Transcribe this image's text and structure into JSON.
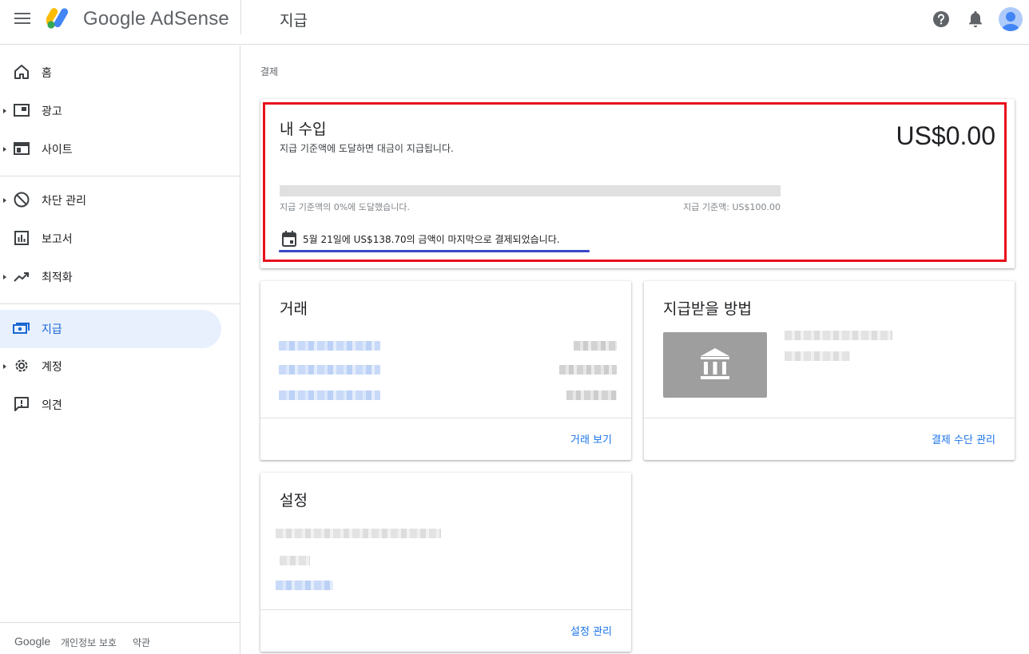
{
  "app": {
    "brand": "Google AdSense",
    "page_title": "지급"
  },
  "header": {
    "icons": [
      "menu-icon",
      "help-icon",
      "notifications-icon",
      "account-avatar"
    ]
  },
  "sidebar": {
    "items": [
      {
        "label": "홈",
        "icon": "home-icon",
        "expandable": false,
        "active": false
      },
      {
        "label": "광고",
        "icon": "ads-icon",
        "expandable": true,
        "active": false
      },
      {
        "label": "사이트",
        "icon": "sites-icon",
        "expandable": true,
        "active": false
      },
      {
        "label": "차단 관리",
        "icon": "block-icon",
        "expandable": true,
        "active": false
      },
      {
        "label": "보고서",
        "icon": "reports-icon",
        "expandable": false,
        "active": false
      },
      {
        "label": "최적화",
        "icon": "trending-icon",
        "expandable": true,
        "active": false
      },
      {
        "label": "지급",
        "icon": "payments-icon",
        "expandable": false,
        "active": true
      },
      {
        "label": "계정",
        "icon": "gear-icon",
        "expandable": true,
        "active": false
      },
      {
        "label": "의견",
        "icon": "feedback-icon",
        "expandable": false,
        "active": false
      }
    ],
    "footer": {
      "brand": "Google",
      "links": [
        "개인정보 보호",
        "약관"
      ]
    }
  },
  "breadcrumb": "결제",
  "earnings": {
    "title": "내 수입",
    "subtitle": "지급 기준액에 도달하면 대금이 지급됩니다.",
    "amount": "US$0.00",
    "progress_fraction": 0.0,
    "progress_left": "지급 기준액의 0%에 도달했습니다.",
    "progress_right": "지급 기준액: US$100.00",
    "last_payment": "5월 21일에 US$138.70의 금액이 마지막으로 결제되었습니다."
  },
  "transactions": {
    "title": "거래",
    "link": "거래 보기"
  },
  "payment_method": {
    "title": "지급받을 방법",
    "link": "결제 수단 관리"
  },
  "settings": {
    "title": "설정",
    "link": "설정 관리"
  },
  "colors": {
    "accent": "#1a73e8",
    "active_nav_bg": "#e8f0fe",
    "highlight_red": "#e8101c",
    "underline_blue": "#3949c7"
  }
}
